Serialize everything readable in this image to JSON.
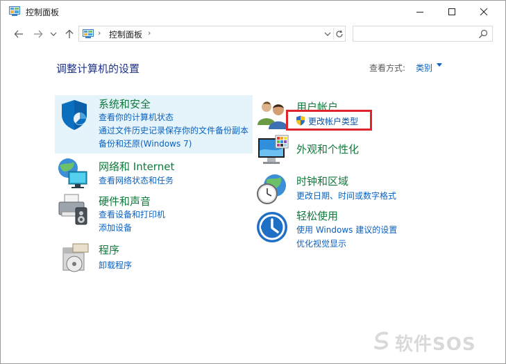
{
  "window": {
    "title": "控制面板",
    "minimize_label": "—",
    "maximize_label": "☐",
    "close_label": "✕"
  },
  "nav": {
    "back_icon": "arrow-left-icon",
    "forward_icon": "arrow-right-icon",
    "up_icon": "arrow-up-icon",
    "address_path": "控制面板",
    "address_separator": "›",
    "search_placeholder": ""
  },
  "main": {
    "heading": "调整计算机的设置",
    "view_by_label": "查看方式:",
    "view_by_value": "类别"
  },
  "categories": [
    {
      "title": "系统和安全",
      "icon": "shield-icon",
      "links": [
        "查看你的计算机状态",
        "通过文件历史记录保存你的文件备份副本",
        "备份和还原(Windows 7)"
      ]
    },
    {
      "title": "网络和 Internet",
      "icon": "network-globe-icon",
      "links": [
        "查看网络状态和任务"
      ]
    },
    {
      "title": "硬件和声音",
      "icon": "printer-icon",
      "links": [
        "查看设备和打印机",
        "添加设备"
      ]
    },
    {
      "title": "程序",
      "icon": "programs-disc-icon",
      "links": [
        "卸载程序"
      ]
    },
    {
      "title": "用户帐户",
      "icon": "users-icon",
      "links": [
        "更改帐户类型"
      ]
    },
    {
      "title": "外观和个性化",
      "icon": "monitor-palette-icon",
      "links": []
    },
    {
      "title": "时钟和区域",
      "icon": "clock-globe-icon",
      "links": [
        "更改日期、时间或数字格式"
      ]
    },
    {
      "title": "轻松使用",
      "icon": "ease-of-access-icon",
      "links": [
        "使用 Windows 建议的设置",
        "优化视觉显示"
      ]
    }
  ],
  "watermark": "软件SOS",
  "colors": {
    "link": "#0a62c2",
    "category_title": "#0f7a3b",
    "heading": "#1e3287",
    "highlight": "#e5f3fb",
    "annotation_box": "#e0242c"
  }
}
